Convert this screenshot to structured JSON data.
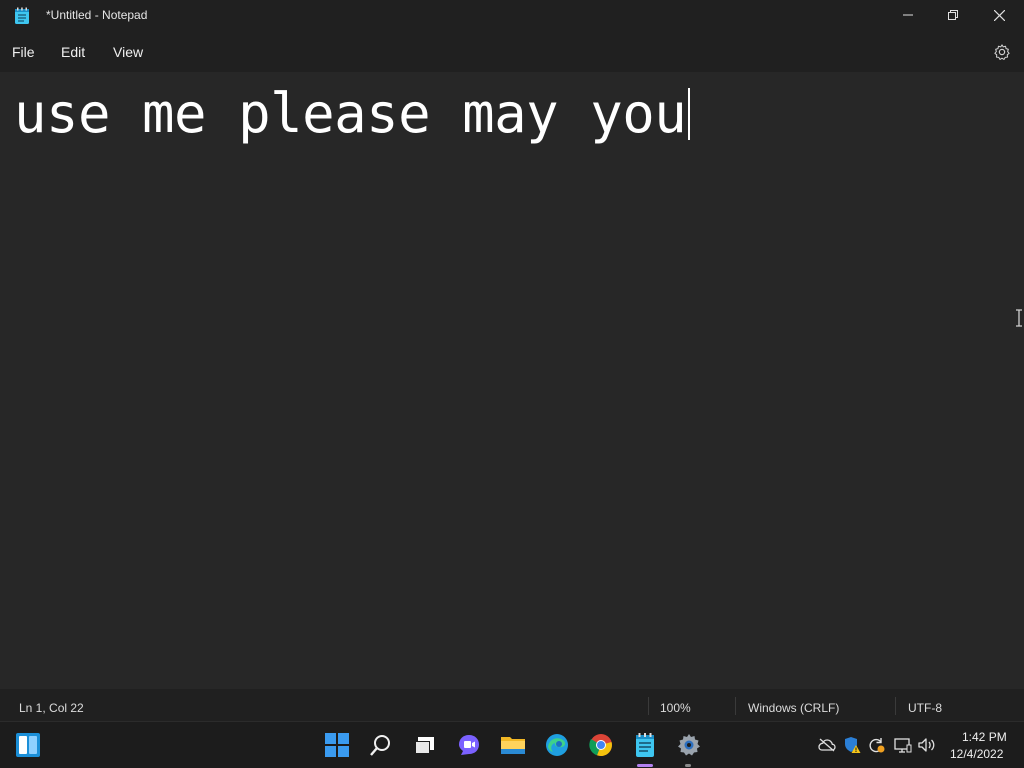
{
  "window": {
    "title": "*Untitled - Notepad"
  },
  "menu": {
    "file": "File",
    "edit": "Edit",
    "view": "View"
  },
  "editor": {
    "content": "use me please may you"
  },
  "status": {
    "position": "Ln 1, Col 22",
    "zoom": "100%",
    "line_ending": "Windows (CRLF)",
    "encoding": "UTF-8"
  },
  "taskbar": {
    "icons": [
      "widgets-icon",
      "start-icon",
      "search-icon",
      "task-view-icon",
      "chat-icon",
      "file-explorer-icon",
      "edge-icon",
      "chrome-icon",
      "notepad-icon",
      "settings-icon"
    ],
    "tray": [
      "onedrive-offline-icon",
      "security-warning-icon",
      "sync-icon",
      "network-icon",
      "volume-icon"
    ],
    "time": "1:42 PM",
    "date": "12/4/2022"
  },
  "colors": {
    "background": "#272727",
    "chrome": "#202020",
    "taskbar": "#1c1c1c",
    "accent": "#b381f0"
  }
}
